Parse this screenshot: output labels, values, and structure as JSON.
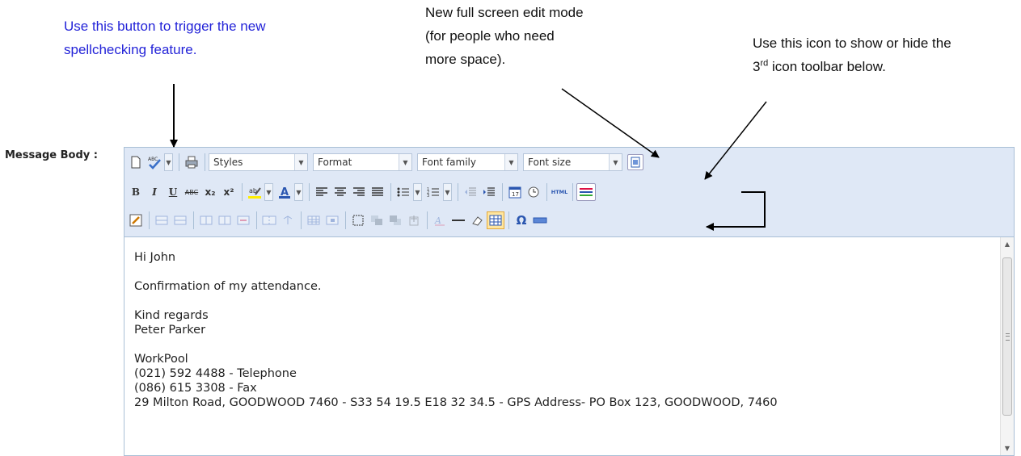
{
  "annotations": {
    "spellcheck": [
      "Use this button to trigger the new",
      "spellchecking feature."
    ],
    "fullscreen": [
      "New full screen edit mode",
      "(for people who need",
      "more space)."
    ],
    "toolbar_toggle": {
      "line1": "Use this icon to show or hide the",
      "line2_prefix": "3",
      "line2_sup": "rd",
      "line2_suffix": " icon toolbar below."
    }
  },
  "form": {
    "label": "Message Body :"
  },
  "toolbar": {
    "combos": {
      "styles": "Styles",
      "format": "Format",
      "font_family": "Font family",
      "font_size": "Font size"
    },
    "bold": "B",
    "italic": "I",
    "underline": "U",
    "strike": "ABC",
    "subscript": "x₂",
    "superscript": "x²",
    "html": "HTML",
    "omega": "Ω"
  },
  "message": {
    "lines": [
      "Hi John",
      "Confirmation of my attendance.",
      "Kind regards",
      "Peter Parker",
      "WorkPool",
      "(021) 592 4488 - Telephone",
      "(086) 615 3308 - Fax",
      "29 Milton Road, GOODWOOD 7460 - S33 54 19.5 E18 32 34.5 - GPS Address- PO Box 123, GOODWOOD, 7460"
    ]
  },
  "colors": {
    "annotation_blue": "#2323d8",
    "toolbar_bg": "#dfe8f6",
    "border": "#a9bfd6"
  }
}
